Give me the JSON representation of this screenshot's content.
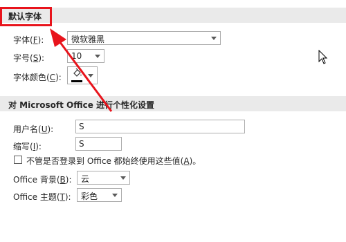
{
  "font_section": {
    "title": "默认字体",
    "font_label": "字体(",
    "font_key": "F",
    "font_label_end": "):",
    "font_value": "微软雅黑",
    "size_label": "字号(",
    "size_key": "S",
    "size_label_end": "):",
    "size_value": "10",
    "color_label": "字体颜色(",
    "color_key": "C",
    "color_label_end": "):"
  },
  "personal_section": {
    "title": "对 Microsoft Office 进行个性化设置",
    "username_label": "用户名(",
    "username_key": "U",
    "username_label_end": "):",
    "username_value": "S",
    "initials_label": "缩写(",
    "initials_key": "I",
    "initials_label_end": "):",
    "initials_value": "S",
    "always_use_label": "不管是否登录到 Office 都始终使用这些值(",
    "always_use_key": "A",
    "always_use_label_end": ")。",
    "always_use_checked": false,
    "background_label": "Office 背景(",
    "background_key": "B",
    "background_label_end": "):",
    "background_value": "云",
    "theme_label": "Office 主题(",
    "theme_key": "T",
    "theme_label_end": "):",
    "theme_value": "彩色"
  },
  "colors": {
    "annotation_red": "#e8141c",
    "header_bg": "#eaeaea",
    "font_color_swatch": "#000000"
  }
}
